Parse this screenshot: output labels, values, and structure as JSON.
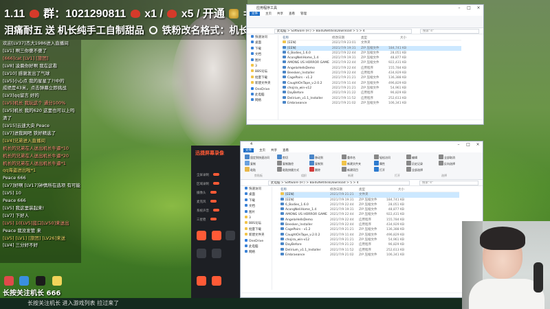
{
  "stream": {
    "banner_line1_prefix": "1.11",
    "banner_group": "群：1021290811",
    "banner_gift1": "x1 /",
    "banner_gift2": "x5 / 开通",
    "banner_gift3": "=",
    "banner_line2": "泪痛耐五 送 机长纯手工自制甜品",
    "banner_line2b": "铁粉改名格式：机长秀",
    "bottom_caption": "长按关注机长 666",
    "colors": {
      "accent": "#ff5a36",
      "highlight": "#cce8ff"
    }
  },
  "chat": {
    "messages": [
      {
        "text": "欢迎[LV37]杰大1986进入直播间",
        "style": ""
      },
      {
        "text": "[LV1] 啊三你傻不傻了",
        "style": ""
      },
      {
        "text": "[666]cat [LV1] [旅团]",
        "style": "hl"
      },
      {
        "text": "[LV8] 凌晨你好啊 我在这看",
        "style": ""
      },
      {
        "text": "[LV10] 感谢发出了气球",
        "style": ""
      },
      {
        "text": "[LV5]小心点 我的星星了?!中的",
        "style": ""
      },
      {
        "text": "成绩是43米，点击弹幕立即挑战",
        "style": ""
      },
      {
        "text": "[LV3]qq留言 好的",
        "style": ""
      },
      {
        "text": "[LV5]机长 我玩这个 通分100%",
        "style": "hl"
      },
      {
        "text": "[LV5]机长 我的620 这里也可以上吗",
        "style": ""
      },
      {
        "text": "清了",
        "style": ""
      },
      {
        "text": "[LV15]云速大央 Peace",
        "style": ""
      },
      {
        "text": "[LV7]进我网吧 铁好精选了",
        "style": ""
      },
      {
        "text": "[LV4]兄弟进入直播间",
        "style": "gold"
      },
      {
        "text": "机长的兄弟在人送出机长牛逼*10",
        "style": "hl"
      },
      {
        "text": "机长的兄弟在人送出机长牛逼*20",
        "style": "hl"
      },
      {
        "text": "机长的兄弟在人送出机长牛逼*1",
        "style": "hl"
      },
      {
        "text": "qq海盗进出啦*1",
        "style": "gold"
      },
      {
        "text": "Peace  666",
        "style": ""
      },
      {
        "text": "[LV7]好啊 [LV17]钟情所在选项 有可能",
        "style": ""
      },
      {
        "text": "[LV5] 10",
        "style": ""
      },
      {
        "text": "Peace  666",
        "style": ""
      },
      {
        "text": "[LV5] 我这里装起来!",
        "style": ""
      },
      {
        "text": "[LV7] 下好人",
        "style": ""
      },
      {
        "text": "[LV5] 10[LV5]蓝口[LV50]来送出",
        "style": "hl"
      },
      {
        "text": "Peace  我没发管 来",
        "style": ""
      },
      {
        "text": "[LV5] [LV1] [旅团] [LV26]来送",
        "style": "gold"
      },
      {
        "text": "[LV4] 三分好不好",
        "style": ""
      }
    ]
  },
  "taskbar": {
    "caption": "长按关注机长  进入游戏列表 拉过来了"
  },
  "explorer_top": {
    "title": "应用程序工具",
    "tabs": [
      "文件",
      "主页",
      "共享",
      "查看",
      "管理"
    ],
    "address": "此电脑 > Software (H:) > BaiduNetdiskDownload > 5 > 4",
    "search_placeholder": "搜索\"4\"",
    "nav": [
      "快速访问",
      "桌面",
      "下载",
      "文档",
      "图片",
      "3",
      "BBS论坛",
      "批量下载",
      "新建文件夹",
      "OneDrive",
      "此电脑",
      "网络"
    ],
    "headers": [
      "名称",
      "修改日期",
      "类型",
      "大小"
    ],
    "files": [
      {
        "name": "[EEN]",
        "date": "2021/7/9 23:01",
        "type": "文件夹",
        "size": "",
        "kind": "folder",
        "sel": false
      },
      {
        "name": "[EEN]",
        "date": "2021/7/9 19:31",
        "type": "ZIP 压缩文件",
        "size": "184,741 KB",
        "kind": "exe",
        "sel": true
      },
      {
        "name": "6_Bodies_1.6.0",
        "date": "2021/7/9 22:44",
        "type": "ZIP 压缩文件",
        "size": "28,051 KB",
        "kind": "exe",
        "sel": false
      },
      {
        "name": "AcongNeliHome_1.4",
        "date": "2021/7/9 19:31",
        "type": "ZIP 压缩文件",
        "size": "48,877 KB",
        "kind": "exe",
        "sel": false
      },
      {
        "name": "AMONG US HORROR GAME",
        "date": "2021/7/9 22:44",
        "type": "ZIP 压缩文件",
        "size": "922,431 KB",
        "kind": "exe",
        "sel": false
      },
      {
        "name": "AngelaHellsDemo",
        "date": "2021/7/9 22:44",
        "type": "应用程序",
        "size": "155,784 KB",
        "kind": "exe",
        "sel": false
      },
      {
        "name": "Beesken_Installer",
        "date": "2021/7/9 22:44",
        "type": "应用程序",
        "size": "434,929 KB",
        "kind": "exe",
        "sel": false
      },
      {
        "name": "CagePairs - v1.2",
        "date": "2021/7/9 21:21",
        "type": "ZIP 压缩文件",
        "size": "136,388 KB",
        "kind": "exe",
        "sel": false
      },
      {
        "name": "CaughtOnTape_v.2.0.2",
        "date": "2021/7/9 11:44",
        "type": "ZIP 压缩文件",
        "size": "496,829 KB",
        "kind": "exe",
        "sel": false
      },
      {
        "name": "chojira_win-v12",
        "date": "2021/7/9 21:21",
        "type": "ZIP 压缩文件",
        "size": "54,961 KB",
        "kind": "exe",
        "sel": false
      },
      {
        "name": "DayBefore",
        "date": "2021/7/9 21:22",
        "type": "应用程序",
        "size": "96,829 KB",
        "kind": "exe",
        "sel": false
      },
      {
        "name": "Delirium_v1.1_Installer",
        "date": "2021/7/9 11:52",
        "type": "应用程序",
        "size": "252,613 KB",
        "kind": "exe",
        "sel": false
      },
      {
        "name": "Embraeance",
        "date": "2021/7/9 21:02",
        "type": "ZIP 压缩文件",
        "size": "106,341 KB",
        "kind": "exe",
        "sel": false
      }
    ]
  },
  "explorer_bottom": {
    "title": "4",
    "tabs": [
      "文件",
      "主页",
      "共享",
      "查看"
    ],
    "ribbon": [
      "固定到快速访问",
      "复制",
      "粘贴",
      "剪切",
      "复制路径",
      "粘贴快捷方式",
      "移动到",
      "复制到",
      "删除",
      "重命名",
      "新建文件夹",
      "新建项目",
      "轻松访问",
      "属性",
      "打开",
      "编辑",
      "历史记录",
      "全部选择",
      "全部取消",
      "反向选择"
    ],
    "ribbon_groups": [
      "剪贴板",
      "组织",
      "新建",
      "打开",
      "选择"
    ],
    "address": "此电脑 > Software (H:) > BaiduNetdiskDownload > 5 > 4",
    "search_placeholder": "搜索\"4\"",
    "nav": [
      "快速访问",
      "桌面",
      "下载",
      "文档",
      "图片",
      "3",
      "BBS论坛",
      "批量下载",
      "新建文件夹",
      "OneDrive",
      "此电脑",
      "网络"
    ],
    "headers": [
      "名称",
      "修改日期",
      "类型",
      "大小"
    ],
    "files": [
      {
        "name": "[EEN]",
        "date": "2021/7/9 21:21",
        "type": "文件夹",
        "size": "",
        "kind": "folder",
        "sel": true
      },
      {
        "name": "[EEN]",
        "date": "2021/7/9 19:31",
        "type": "ZIP 压缩文件",
        "size": "184,741 KB",
        "kind": "exe",
        "sel": false
      },
      {
        "name": "6_Bodies_1.6.0",
        "date": "2021/7/9 22:44",
        "type": "ZIP 压缩文件",
        "size": "28,051 KB",
        "kind": "exe",
        "sel": false
      },
      {
        "name": "AcongNeliHome_1.4",
        "date": "2021/7/9 19:31",
        "type": "ZIP 压缩文件",
        "size": "48,877 KB",
        "kind": "exe",
        "sel": false
      },
      {
        "name": "AMONG US HORROR GAME",
        "date": "2021/7/9 22:44",
        "type": "ZIP 压缩文件",
        "size": "922,431 KB",
        "kind": "exe",
        "sel": false
      },
      {
        "name": "AngelaHellsDemo",
        "date": "2021/7/9 22:44",
        "type": "应用程序",
        "size": "155,784 KB",
        "kind": "exe",
        "sel": false
      },
      {
        "name": "Beesken_Installer",
        "date": "2021/7/9 22:44",
        "type": "应用程序",
        "size": "434,929 KB",
        "kind": "exe",
        "sel": false
      },
      {
        "name": "CagePairs - v1.2",
        "date": "2021/7/9 21:21",
        "type": "ZIP 压缩文件",
        "size": "136,388 KB",
        "kind": "exe",
        "sel": false
      },
      {
        "name": "CaughtOnTape_v.2.0.2",
        "date": "2021/7/9 11:44",
        "type": "ZIP 压缩文件",
        "size": "496,829 KB",
        "kind": "exe",
        "sel": false
      },
      {
        "name": "chojira_win-v12",
        "date": "2021/7/9 21:21",
        "type": "ZIP 压缩文件",
        "size": "54,961 KB",
        "kind": "exe",
        "sel": false
      },
      {
        "name": "DayBefore",
        "date": "2021/7/9 21:22",
        "type": "应用程序",
        "size": "96,829 KB",
        "kind": "exe",
        "sel": false
      },
      {
        "name": "Delirium_v1.1_Installer",
        "date": "2021/7/9 11:52",
        "type": "应用程序",
        "size": "252,613 KB",
        "kind": "exe",
        "sel": false
      },
      {
        "name": "Embraeance",
        "date": "2021/7/9 21:02",
        "type": "ZIP 压缩文件",
        "size": "106,341 KB",
        "kind": "exe",
        "sel": false
      }
    ]
  },
  "recorder": {
    "logo": "迅捷屏幕录像",
    "rows": [
      "全屏录制",
      "区域录制",
      "摄像头",
      "麦克风",
      "系统声音",
      "三星稳"
    ],
    "buttons": [
      "开始录制",
      "暂停",
      "停止",
      "设置"
    ]
  }
}
